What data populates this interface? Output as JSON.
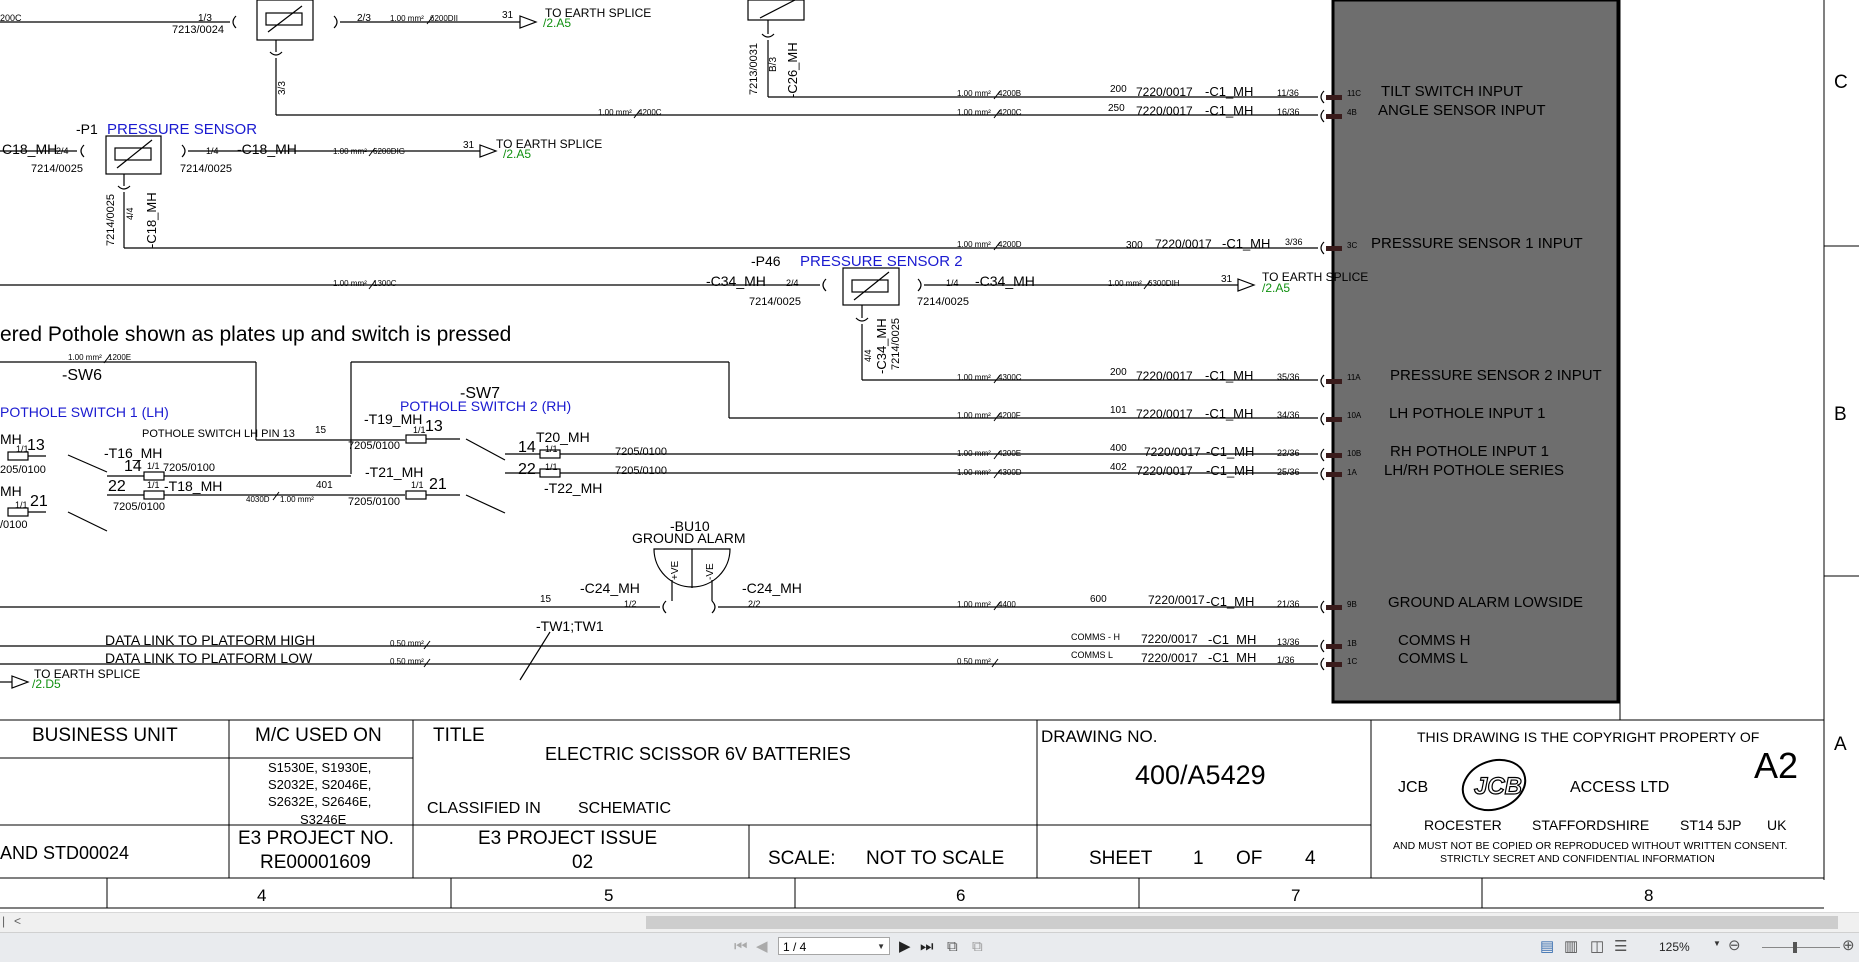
{
  "schematic": {
    "labels": {
      "to_earth_splice": "TO EARTH SPLICE",
      "ref_2a5": "/2.A5",
      "ref_2d5": "/2.D5",
      "p1": "-P1",
      "pressure_sensor": "PRESSURE SENSOR",
      "p46": "-P46",
      "pressure_sensor_2": "PRESSURE SENSOR 2",
      "pothole_note": "ered Pothole shown as plates up and switch is pressed",
      "sw6": "-SW6",
      "sw7": "-SW7",
      "pothole_switch_1": "POTHOLE SWITCH 1 (LH)",
      "pothole_switch_2": "POTHOLE SWITCH 2 (RH)",
      "pothole_switch_lh_pin": "POTHOLE SWITCH LH PIN 13",
      "bu10": "-BU10",
      "ground_alarm": "GROUND ALARM",
      "plus_ve": "+VE",
      "minus_ve": "-VE",
      "tw1": "-TW1;TW1",
      "data_link_high": "DATA LINK TO PLATFORM HIGH",
      "data_link_low": "DATA LINK TO PLATFORM LOW",
      "comms_h": "COMMS - H",
      "comms_l": "COMMS L"
    },
    "connectors": {
      "c18": "-C18_MH",
      "c18_partial": "C18_MH",
      "c26": "-C26_MH",
      "c34": "-C34_MH",
      "c24": "-C24_MH",
      "c1": "-C1_MH",
      "t16": "-T16_MH",
      "t18": "-T18_MH",
      "t19": "-T19_MH",
      "t20": "T20_MH",
      "t21": "-T21_MH",
      "t22": "-T22_MH",
      "mh_partial": "MH"
    },
    "codes": {
      "c7213_0024": "7213/0024",
      "c7213_0031": "7213/0031",
      "c7214_0025": "7214/0025",
      "c7220_0017": "7220/0017",
      "c7205_0100": "7205/0100",
      "c205_0100": "205/0100",
      "c0100": "/0100",
      "c200c": "200C",
      "pin_1_3": "1/3",
      "pin_2_3": "2/3",
      "pin_3_3": "3/3",
      "pin_b3": "B/3",
      "pin_2_4": "2/4",
      "pin_1_4": "1/4",
      "pin_4_4": "4/4",
      "pin_1_1": "1/1",
      "pin_1_2": "1/2",
      "pin_2_2": "2/2",
      "n13": "13",
      "n14": "14",
      "n21": "21",
      "n22": "22",
      "n15": "15",
      "n31": "31",
      "n401": "401",
      "w4030d": "4030D",
      "w200": "200",
      "w250": "250",
      "w300": "300",
      "w101": "101",
      "w400": "400",
      "w402": "402",
      "w600": "600",
      "gauge_100": "1.00 mm²",
      "gauge_050": "0.50 mm²",
      "g6200dii": "6200DII",
      "g6200dig": "6200DIG",
      "g6300dih": "6300DIH",
      "g4200b": "4200B",
      "g4200c": "4200C",
      "g4200d": "4200D",
      "g1300c": "1300C",
      "g1200e": "1200E",
      "g4300c": "4300C",
      "g4200f": "4200F",
      "g4200e": "4200E",
      "g4300d": "4300D",
      "g4400": "4400"
    },
    "ecu_inputs": [
      {
        "pin": "11/36",
        "term": "11C",
        "label": "TILT SWITCH INPUT"
      },
      {
        "pin": "16/36",
        "term": "4B",
        "label": "ANGLE SENSOR INPUT"
      },
      {
        "pin": "3/36",
        "term": "3C",
        "label": "PRESSURE SENSOR 1 INPUT"
      },
      {
        "pin": "35/36",
        "term": "11A",
        "label": "PRESSURE SENSOR 2 INPUT"
      },
      {
        "pin": "34/36",
        "term": "10A",
        "label": "LH POTHOLE INPUT 1"
      },
      {
        "pin": "22/36",
        "term": "10B",
        "label": "RH POTHOLE INPUT 1"
      },
      {
        "pin": "25/36",
        "term": "1A",
        "label": "LH/RH POTHOLE SERIES"
      },
      {
        "pin": "21/36",
        "term": "9B",
        "label": "GROUND ALARM LOWSIDE"
      },
      {
        "pin": "13/36",
        "term": "1B",
        "label": "COMMS H"
      },
      {
        "pin": "1/36",
        "term": "1C",
        "label": "COMMS L"
      }
    ],
    "border_letters": [
      "C",
      "B",
      "A"
    ],
    "column_numbers": [
      "4",
      "5",
      "6",
      "7",
      "8"
    ]
  },
  "title_block": {
    "business_unit": "BUSINESS UNIT",
    "mc_used_on": "M/C USED ON",
    "models": [
      "S1530E, S1930E,",
      "S2032E, S2046E,",
      "S2632E, S2646E,",
      "S3246E"
    ],
    "title_label": "TITLE",
    "title": "ELECTRIC SCISSOR 6V BATTERIES",
    "classified_label": "CLASSIFIED IN",
    "classified_value": "SCHEMATIC",
    "drawing_no_label": "DRAWING NO.",
    "drawing_no": "400/A5429",
    "copyright": "THIS DRAWING IS THE COPYRIGHT PROPERTY OF",
    "size": "A2",
    "company_left": "JCB",
    "company_right": "ACCESS LTD",
    "address": [
      "ROCESTER",
      "STAFFORDSHIRE",
      "ST14 5JP",
      "UK"
    ],
    "notice_1": "AND MUST NOT BE COPIED OR REPRODUCED WITHOUT WRITTEN CONSENT.",
    "notice_2": "STRICTLY SECRET AND CONFIDENTIAL INFORMATION",
    "std": "AND STD00024",
    "project_no_label": "E3 PROJECT NO.",
    "project_no": "RE00001609",
    "project_issue_label": "E3 PROJECT ISSUE",
    "project_issue": "02",
    "scale_label": "SCALE:",
    "scale_value": "NOT TO SCALE",
    "sheet_label": "SHEET",
    "sheet_no": "1",
    "of_label": "OF",
    "sheet_total": "4"
  },
  "viewer": {
    "page_indicator": "1 / 4",
    "zoom": "125%"
  },
  "colors": {
    "ecu_fill": "#6e6e6e",
    "component_label": "#1a1ad0",
    "cross_ref": "#109010",
    "statusbar": "#e9ebee"
  }
}
